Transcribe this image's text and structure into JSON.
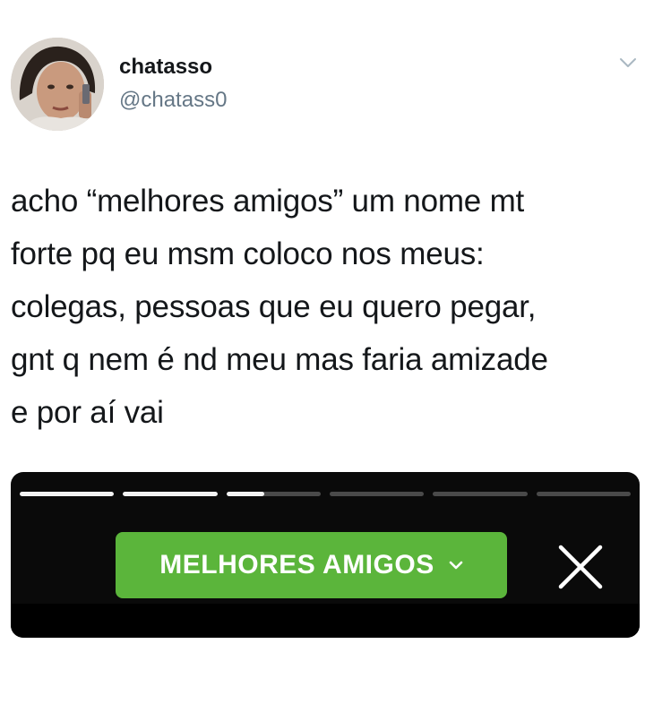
{
  "tweet": {
    "display_name": "chatasso",
    "handle": "@chatass0",
    "text": "acho “melhores amigos” um nome mt\nforte pq eu msm coloco nos meus:\ncolegas, pessoas que eu quero pegar,\ngnt q nem é nd meu mas faria amizade\ne por aí vai"
  },
  "icons": {
    "avatar": "profile-photo",
    "more": "chevron-down-icon",
    "audience_chevron": "chevron-down-icon",
    "close": "close-icon"
  },
  "story": {
    "audience_label": "MELHORES AMIGOS",
    "progress_segments": [
      1.0,
      1.0,
      0.4,
      0.0,
      0.0,
      0.0
    ],
    "colors": {
      "panel": "#0a0a0a",
      "button": "#5bb53b",
      "progress_done": "#f2f2f2",
      "progress_pending": "#4a4a4a"
    }
  }
}
